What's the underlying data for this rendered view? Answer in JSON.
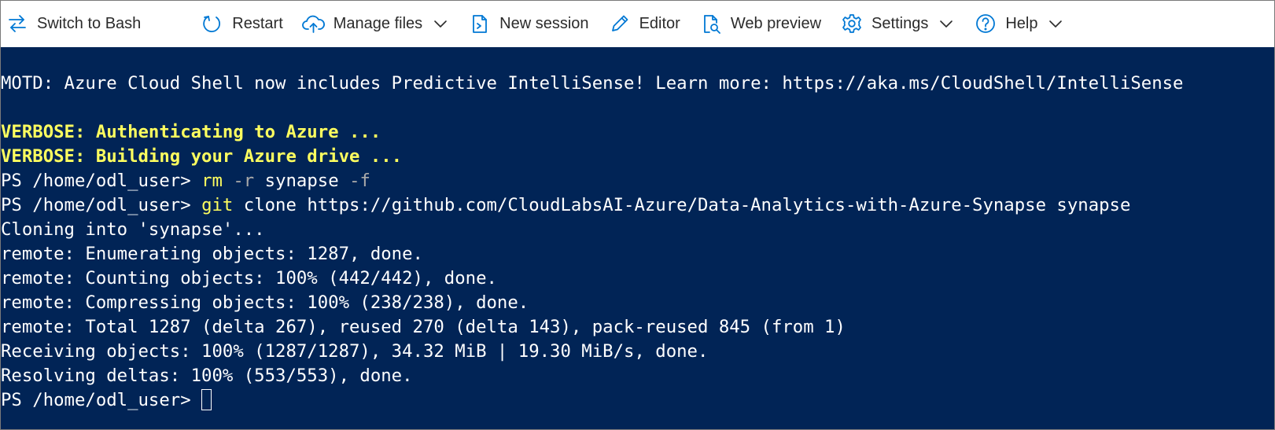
{
  "toolbar": {
    "switch_label": "Switch to Bash",
    "restart_label": "Restart",
    "manage_files_label": "Manage files",
    "new_session_label": "New session",
    "editor_label": "Editor",
    "web_preview_label": "Web preview",
    "settings_label": "Settings",
    "help_label": "Help",
    "icons": {
      "switch": "switch-arrows-icon",
      "restart": "restart-icon",
      "manage_files": "cloud-upload-icon",
      "new_session": "new-session-icon",
      "editor": "pencil-icon",
      "web_preview": "web-preview-icon",
      "settings": "gear-icon",
      "help": "help-icon"
    },
    "accent_color": "#0078d4"
  },
  "terminal": {
    "background": "#012456",
    "motd": "MOTD: Azure Cloud Shell now includes Predictive IntelliSense! Learn more: https://aka.ms/CloudShell/IntelliSense",
    "verbose_1": "VERBOSE: Authenticating to Azure ...",
    "verbose_2": "VERBOSE: Building your Azure drive ...",
    "prompt": "PS /home/odl_user> ",
    "cmd1_name": "rm",
    "cmd1_flag1": "-r",
    "cmd1_arg": "synapse",
    "cmd1_flag2": "-f",
    "cmd2_name": "git",
    "cmd2_args": "clone https://github.com/CloudLabsAI-Azure/Data-Analytics-with-Azure-Synapse synapse",
    "output": [
      "Cloning into 'synapse'...",
      "remote: Enumerating objects: 1287, done.",
      "remote: Counting objects: 100% (442/442), done.",
      "remote: Compressing objects: 100% (238/238), done.",
      "remote: Total 1287 (delta 267), reused 270 (delta 143), pack-reused 845 (from 1)",
      "Receiving objects: 100% (1287/1287), 34.32 MiB | 19.30 MiB/s, done.",
      "Resolving deltas: 100% (553/553), done."
    ],
    "final_prompt": "PS /home/odl_user> "
  }
}
